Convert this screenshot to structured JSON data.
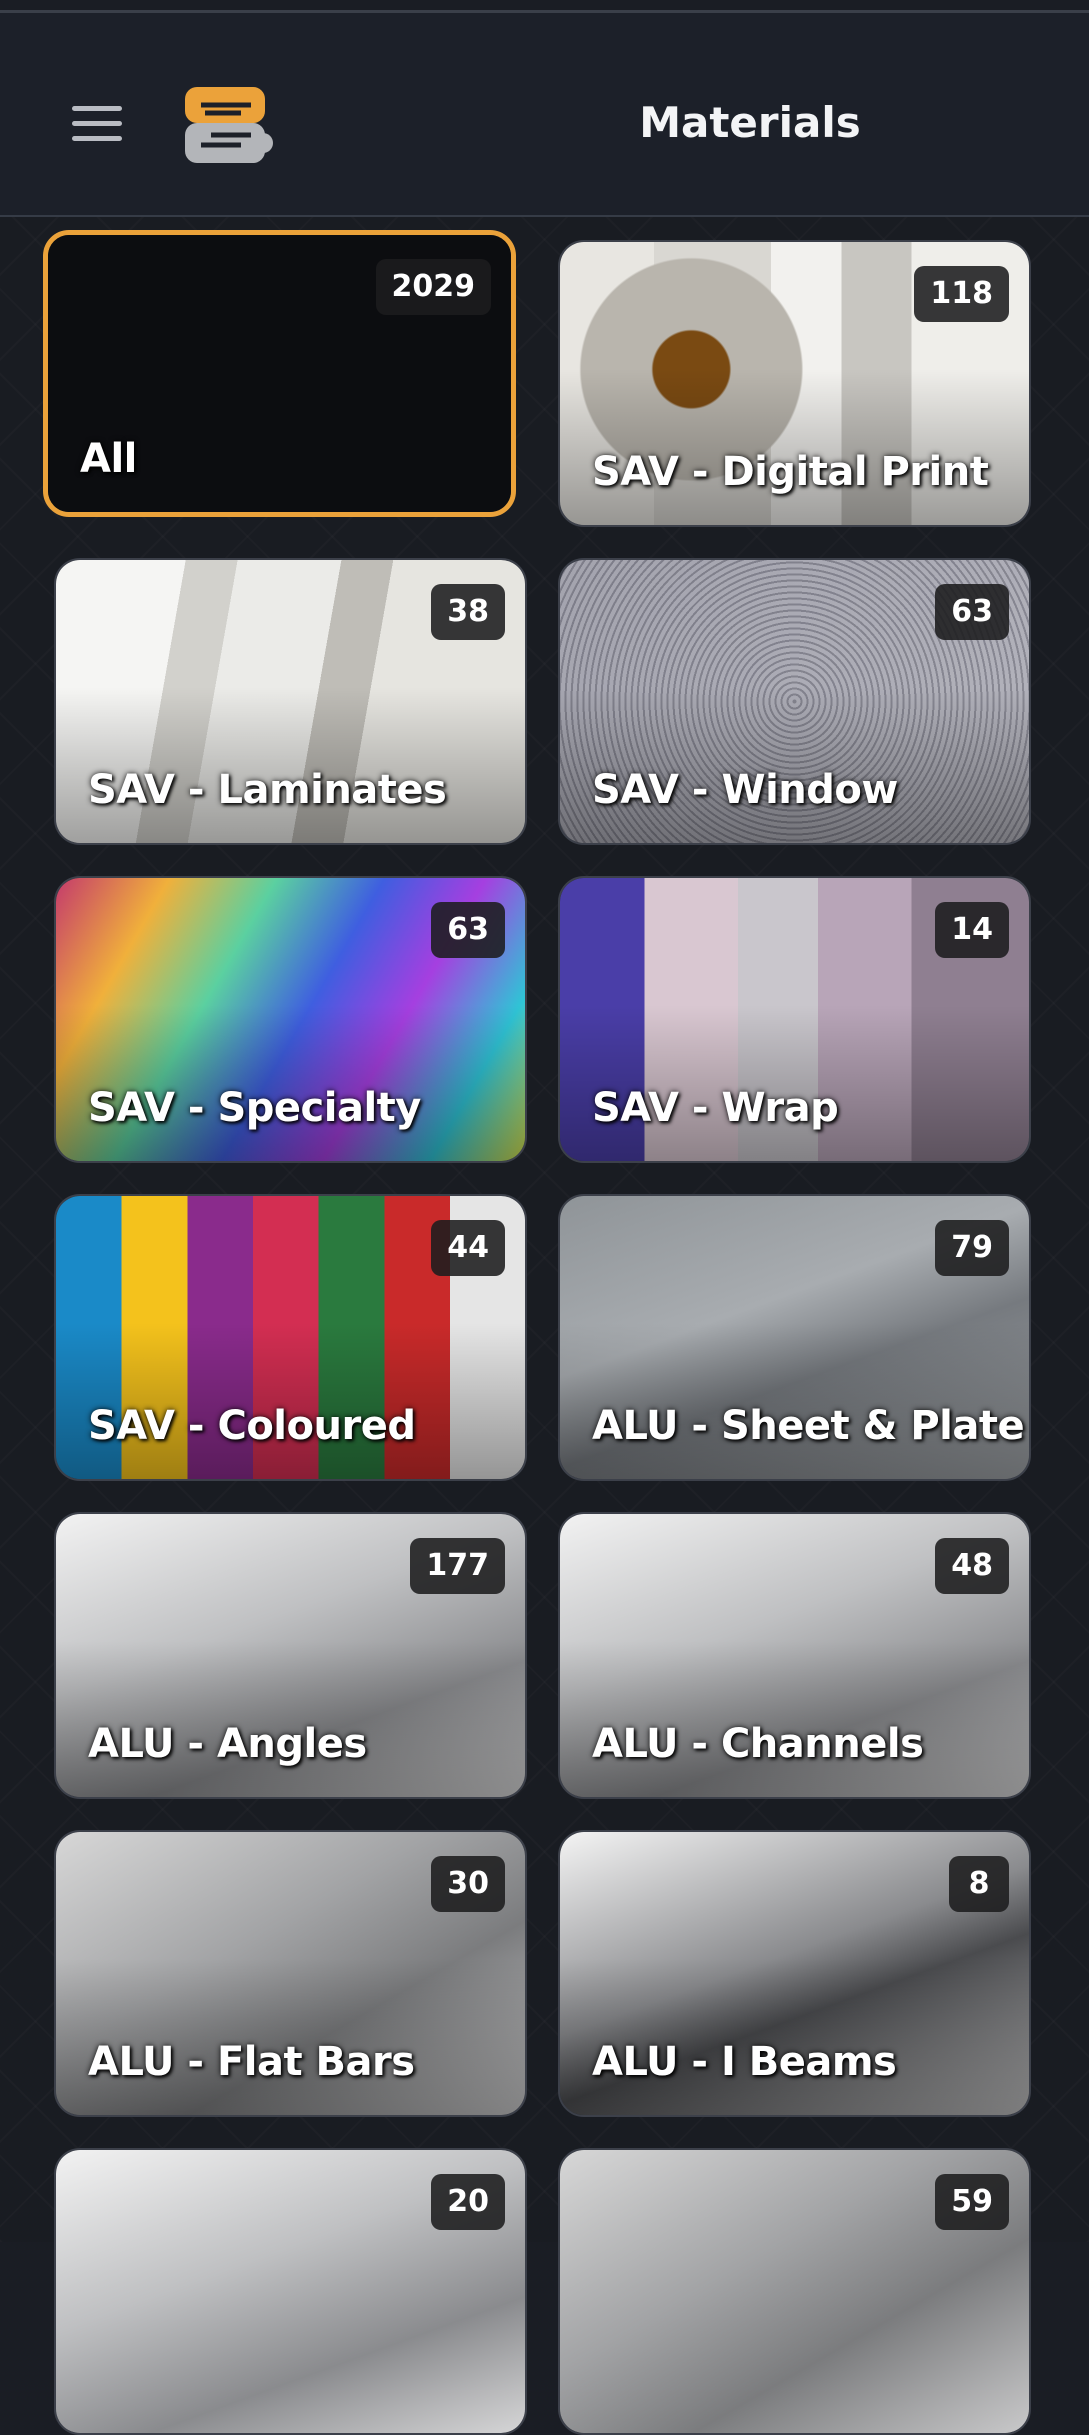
{
  "header": {
    "title": "Materials"
  },
  "colors": {
    "accent": "#eba23a",
    "background": "#1a1d24",
    "badge": "#1c1c1e"
  },
  "categories": [
    {
      "label": "All",
      "count": "2029",
      "selected": true
    },
    {
      "label": "SAV - Digital Print",
      "count": "118"
    },
    {
      "label": "SAV - Laminates",
      "count": "38"
    },
    {
      "label": "SAV - Window",
      "count": "63"
    },
    {
      "label": "SAV - Specialty",
      "count": "63"
    },
    {
      "label": "SAV - Wrap",
      "count": "14"
    },
    {
      "label": "SAV - Coloured",
      "count": "44"
    },
    {
      "label": "ALU - Sheet & Plate",
      "count": "79"
    },
    {
      "label": "ALU - Angles",
      "count": "177"
    },
    {
      "label": "ALU - Channels",
      "count": "48"
    },
    {
      "label": "ALU - Flat Bars",
      "count": "30"
    },
    {
      "label": "ALU - I Beams",
      "count": "8"
    },
    {
      "label": "",
      "count": "20"
    },
    {
      "label": "",
      "count": "59"
    }
  ]
}
